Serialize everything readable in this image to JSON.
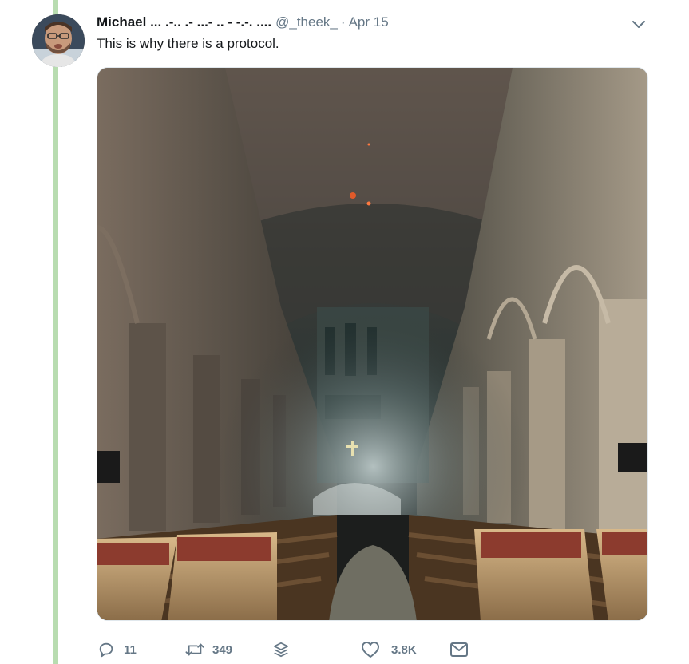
{
  "tweet": {
    "author_name": "Michael ... .-.. .- ...- .. - -.-. ....",
    "author_handle": "@_theek_",
    "separator": "·",
    "date": "Apr 15",
    "text": "This is why there is a protocol."
  },
  "media": {
    "description_icon": "photo",
    "alt": ""
  },
  "actions": {
    "reply_count": "11",
    "retweet_count": "349",
    "like_count": "3.8K"
  },
  "icons": {
    "reply": "reply-icon",
    "retweet": "retweet-icon",
    "stack": "stack-icon",
    "like": "heart-icon",
    "message": "mail-icon",
    "caret": "chevron-down-icon"
  },
  "colors": {
    "thread_line": "#b8dcb0",
    "muted": "#657786",
    "text": "#14171a"
  }
}
